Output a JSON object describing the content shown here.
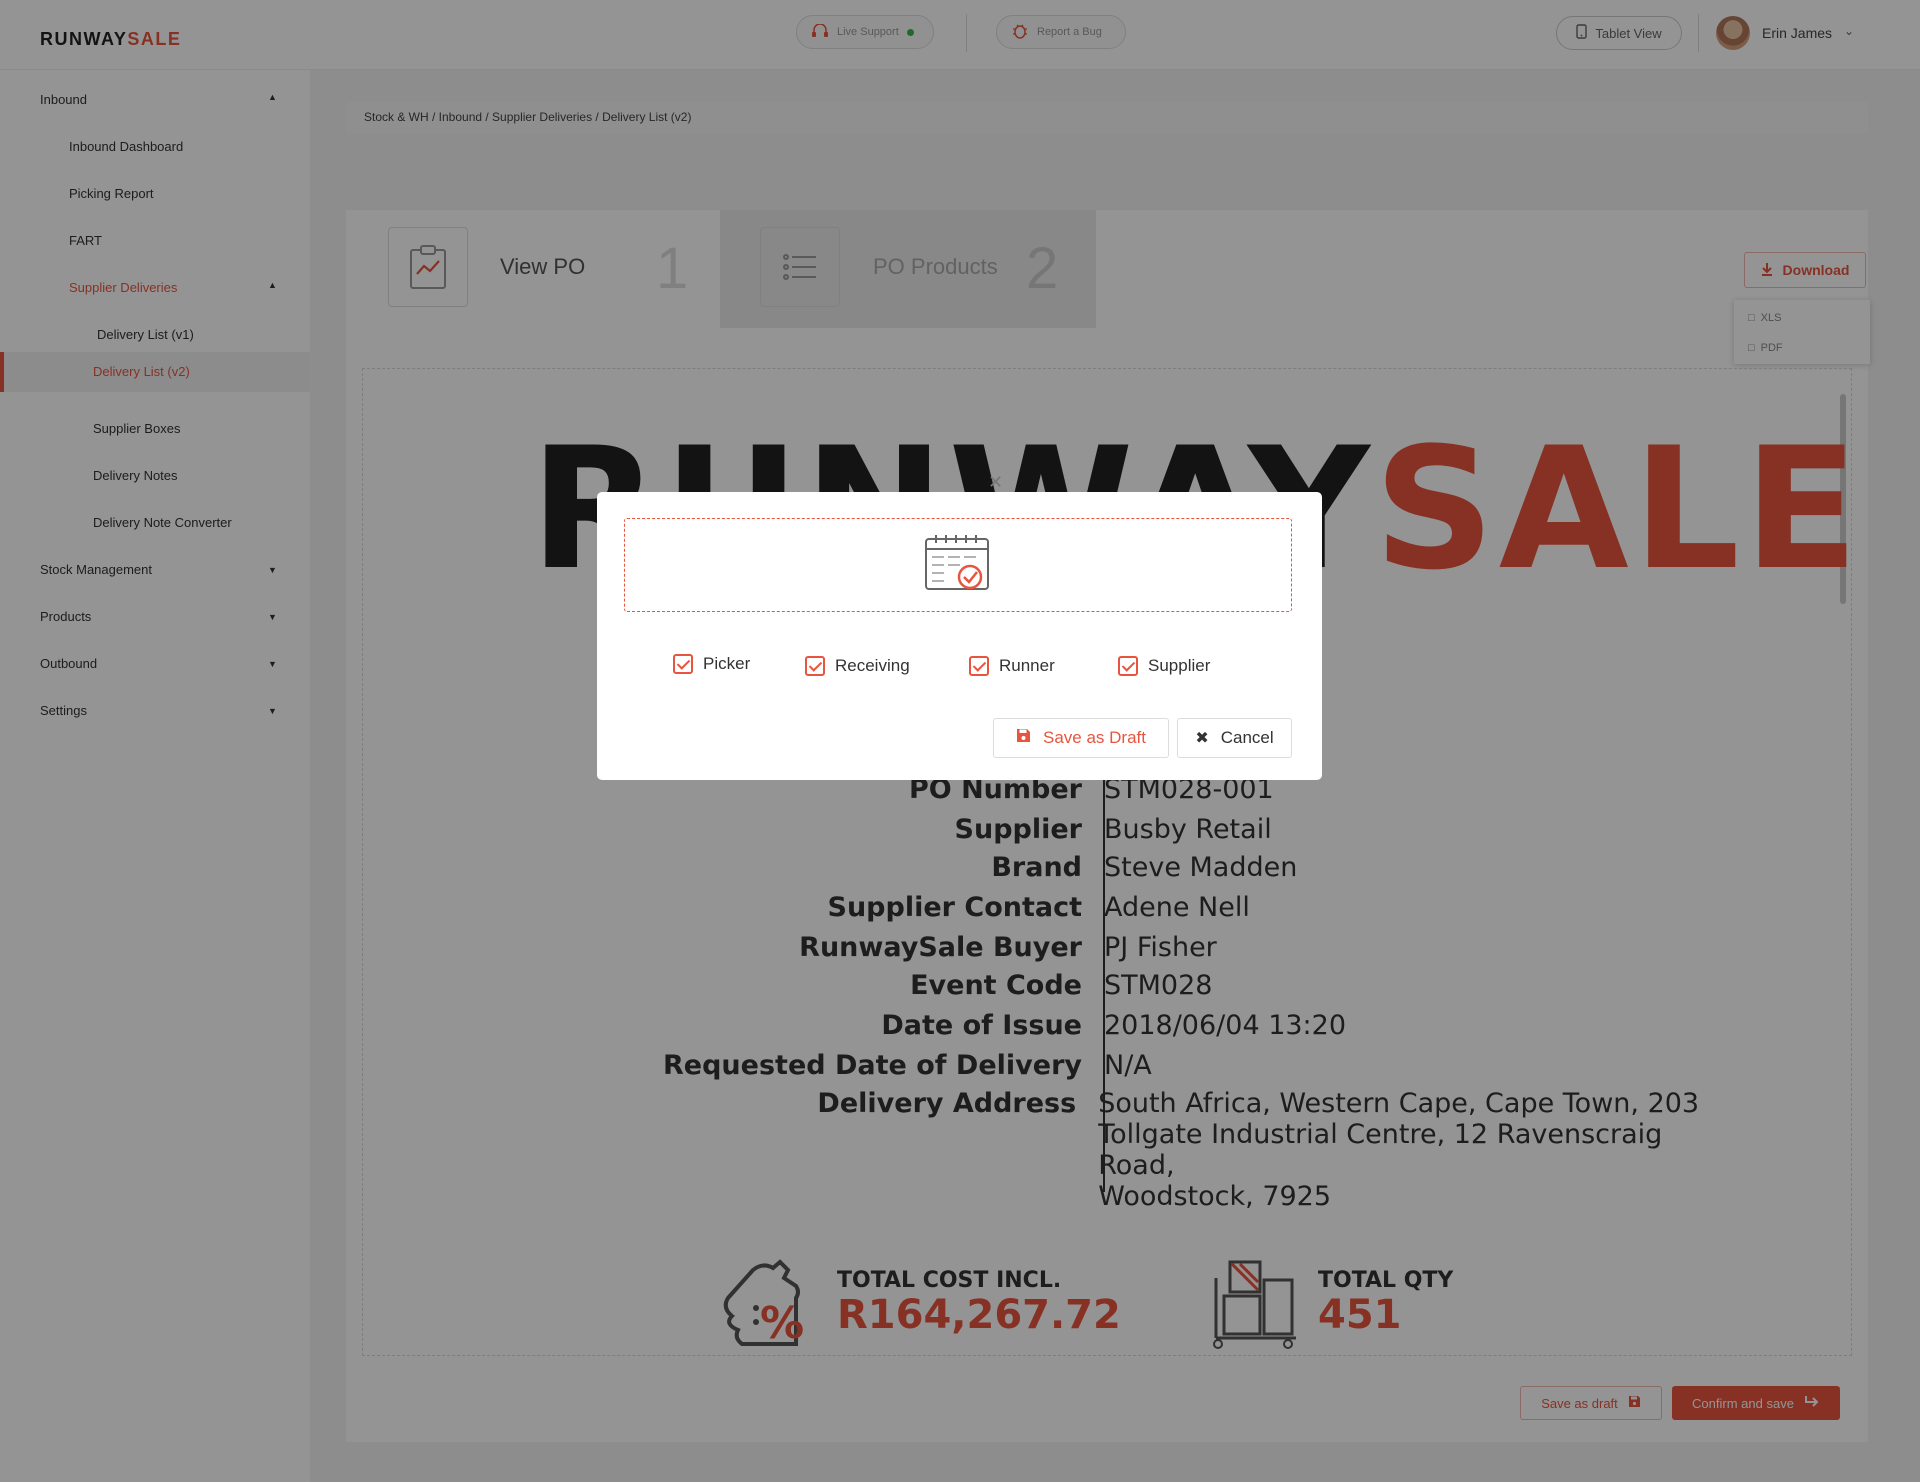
{
  "brand": {
    "logo_part1": "RUNWAY",
    "logo_part2": "SALE",
    "accent": "#e8553f"
  },
  "topbar": {
    "live_support": "Live Support",
    "report_bug": "Report a Bug",
    "tablet_view": "Tablet View",
    "user_name": "Erin James"
  },
  "sidebar": {
    "items": [
      {
        "label": "Inbound"
      },
      {
        "label": "Inbound Dashboard"
      },
      {
        "label": "Picking Report"
      },
      {
        "label": "FART"
      },
      {
        "label": "Supplier Deliveries"
      },
      {
        "label": "Delivery List (v1)"
      },
      {
        "label": "Delivery List (v2)"
      },
      {
        "label": "Supplier Boxes"
      },
      {
        "label": "Delivery Notes"
      },
      {
        "label": "Delivery Note Converter"
      },
      {
        "label": "Stock Management"
      },
      {
        "label": "Products"
      },
      {
        "label": "Outbound"
      },
      {
        "label": "Settings"
      }
    ]
  },
  "breadcrumb": "Stock & WH / Inbound  / Supplier Deliveries / Delivery List (v2)",
  "tabs": [
    {
      "label": "View PO",
      "number": "1"
    },
    {
      "label": "PO Products",
      "number": "2"
    }
  ],
  "download": {
    "label": "Download",
    "options": [
      "XLS",
      "PDF"
    ]
  },
  "document": {
    "logo_part1": "RUNWAY",
    "logo_part2": "SALE",
    "fields": [
      {
        "key": "PO Number",
        "value": "STM028-001"
      },
      {
        "key": "Supplier",
        "value": "Busby Retail"
      },
      {
        "key": "Brand",
        "value": "Steve Madden"
      },
      {
        "key": "Supplier Contact",
        "value": "Adene Nell"
      },
      {
        "key": "RunwaySale Buyer",
        "value": "PJ Fisher"
      },
      {
        "key": "Event Code",
        "value": "STM028"
      },
      {
        "key": "Date of Issue",
        "value": "2018/06/04 13:20"
      },
      {
        "key": "Requested Date of Delivery",
        "value": "N/A"
      },
      {
        "key": "Delivery Address",
        "value": "South Africa, Western Cape, Cape Town, 203",
        "value2": "Tollgate Industrial Centre, 12 Ravenscraig Road,",
        "value3": "Woodstock, 7925"
      }
    ],
    "total_cost_label": "TOTAL COST INCL.",
    "total_cost_value": "R164,267.72",
    "total_qty_label": "TOTAL QTY",
    "total_qty_value": "451"
  },
  "footer_actions": {
    "save_draft": "Save as draft",
    "confirm_save": "Confirm and save"
  },
  "modal": {
    "checkboxes": [
      {
        "label": "Picker",
        "checked": true
      },
      {
        "label": "Receiving",
        "checked": true
      },
      {
        "label": "Runner",
        "checked": true
      },
      {
        "label": "Supplier",
        "checked": true
      }
    ],
    "save_draft": "Save as Draft",
    "cancel": "Cancel"
  }
}
